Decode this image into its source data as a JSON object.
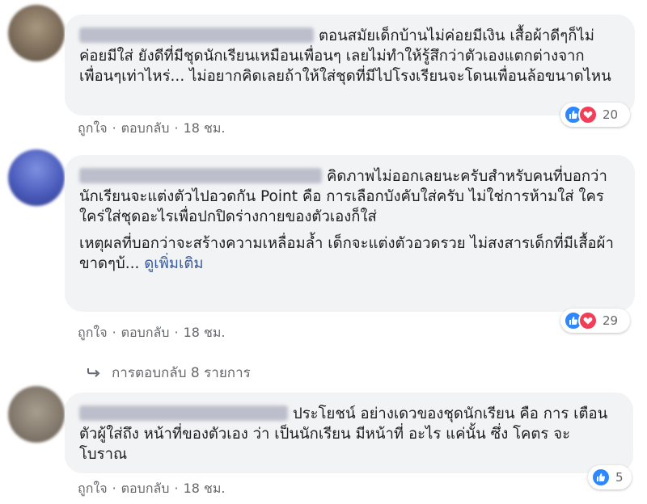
{
  "comments": [
    {
      "avatar_color": "#8a7a66",
      "text": "ตอนสมัยเด็กบ้านไม่ค่อยมีเงิน เสื้อผ้าดีๆก็ไม่ค่อยมีใส่ ยังดีที่มีชุดนักเรียนเหมือนเพื่อนๆ เลยไม่ทำให้รู้สึกว่าตัวเองแตกต่างจากเพื่อนๆเท่าไหร่... ไม่อยากคิดเลยถ้าให้ใส่ชุดที่มีไปโรงเรียนจะโดนเพื่อนล้อขนาดไหน",
      "reactions": [
        "like",
        "love"
      ],
      "reaction_count": "20",
      "actions": {
        "like": "ถูกใจ",
        "reply": "ตอบกลับ",
        "time": "18 ชม."
      }
    },
    {
      "avatar_color": "#4d5fb8",
      "text": "คิดภาพไม่ออกเลยนะครับสำหรับคนที่บอกว่านักเรียนจะแต่งตัวไปอวดกัน Point คือ การเลือกบังคับใส่ครับ ไม่ใช่การห้ามใส่ ใครใคร่ใส่ชุดอะไรเพื่อปกปิดร่างกายของตัวเองก็ใส่",
      "text2": "เหตุผลที่บอกว่าจะสร้างความเหลื่อมล้ำ เด็กจะแต่งตัวอวดรวย ไม่สงสารเด็กที่มีเสื้อผ้าขาดๆบ้...",
      "see_more": "ดูเพิ่มเติม",
      "reactions": [
        "like",
        "love"
      ],
      "reaction_count": "29",
      "actions": {
        "like": "ถูกใจ",
        "reply": "ตอบกลับ",
        "time": "18 ชม."
      },
      "replies_label": "การตอบกลับ 8 รายการ"
    },
    {
      "avatar_color": "#8f8678",
      "text": "ประโยชน์ อย่างเดวของชุดนักเรียน คือ การ เตือนตัวผู้ใส่ถึง หน้าที่ของตัวเอง ว่า เป็นนักเรียน มีหน้าที่ อะไร แค่นั้น ซึ่ง โคตร จะ โบราณ",
      "reactions": [
        "like"
      ],
      "reaction_count": "5",
      "actions": {
        "like": "ถูกใจ",
        "reply": "ตอบกลับ",
        "time": "18 ชม."
      }
    }
  ]
}
